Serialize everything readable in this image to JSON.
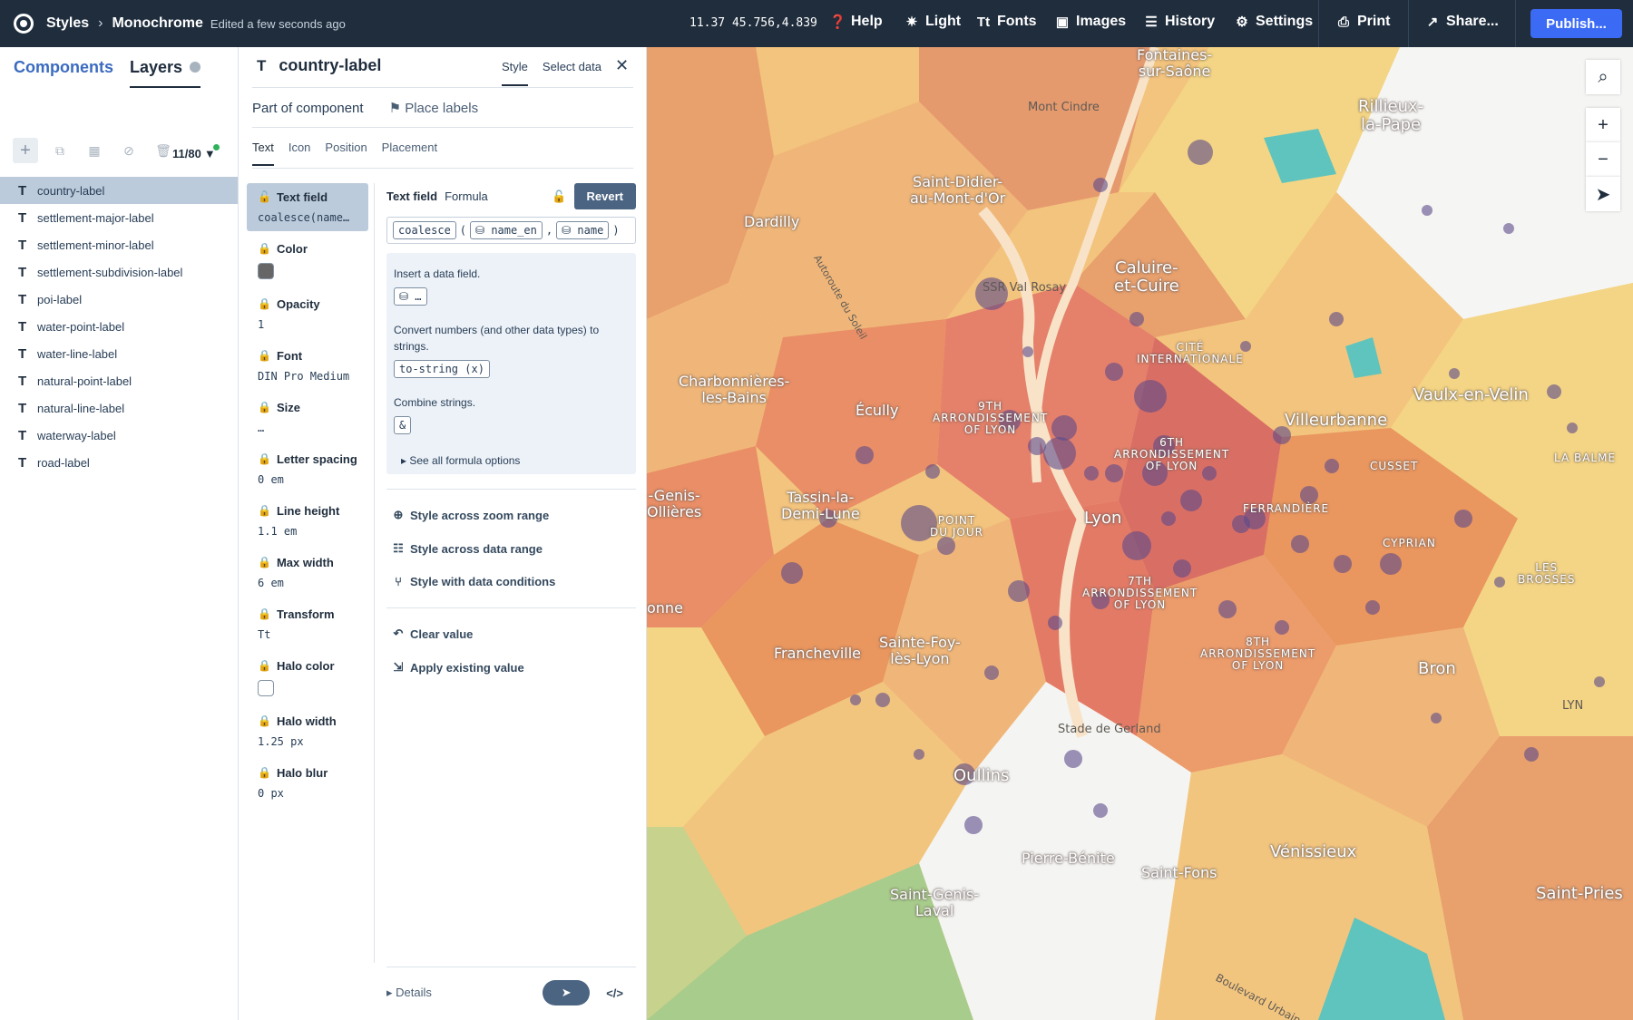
{
  "topbar": {
    "app": "Styles",
    "style_name": "Monochrome",
    "edited": "Edited a few seconds ago",
    "coords": "11.37 45.756,4.839",
    "menu": [
      {
        "label": "Help",
        "icon": "help-icon"
      },
      {
        "label": "Light",
        "icon": "light-icon"
      },
      {
        "label": "Fonts",
        "icon": "fonts-icon"
      },
      {
        "label": "Images",
        "icon": "images-icon"
      },
      {
        "label": "History",
        "icon": "history-icon"
      },
      {
        "label": "Settings",
        "icon": "settings-icon"
      },
      {
        "label": "Print",
        "icon": "print-icon"
      },
      {
        "label": "Share...",
        "icon": "share-icon"
      }
    ],
    "publish": "Publish..."
  },
  "left": {
    "tabs": [
      "Components",
      "Layers"
    ],
    "count": "11/80",
    "layers": [
      "country-label",
      "settlement-major-label",
      "settlement-minor-label",
      "settlement-subdivision-label",
      "poi-label",
      "water-point-label",
      "water-line-label",
      "natural-point-label",
      "natural-line-label",
      "waterway-label",
      "road-label"
    ],
    "selected_layer": "country-label"
  },
  "panel": {
    "title": "country-label",
    "tabs": [
      "Style",
      "Select data"
    ],
    "part_of": "Part of component",
    "component": "Place labels",
    "subtabs": [
      "Text",
      "Icon",
      "Position",
      "Placement"
    ],
    "props": [
      {
        "label": "Text field",
        "value": "coalesce(name…"
      },
      {
        "label": "Color",
        "value": ""
      },
      {
        "label": "Opacity",
        "value": "1"
      },
      {
        "label": "Font",
        "value": "DIN Pro Medium"
      },
      {
        "label": "Size",
        "value": "…"
      },
      {
        "label": "Letter spacing",
        "value": "0 em"
      },
      {
        "label": "Line height",
        "value": "1.1 em"
      },
      {
        "label": "Max width",
        "value": "6 em"
      },
      {
        "label": "Transform",
        "value": "Tt"
      },
      {
        "label": "Halo color",
        "value": ""
      },
      {
        "label": "Halo width",
        "value": "1.25 px"
      },
      {
        "label": "Halo blur",
        "value": "0 px"
      }
    ],
    "field_label": "Text field",
    "field_mode": "Formula",
    "revert": "Revert",
    "expr": {
      "fn": "coalesce",
      "a": "name_en",
      "b": "name"
    },
    "help": {
      "insert": "Insert a data field.",
      "insert_chip": "…",
      "convert": "Convert numbers (and other data types) to strings.",
      "convert_chip": "to-string (x)",
      "combine": "Combine strings.",
      "combine_chip": "&",
      "see_all": "See all formula options"
    },
    "actions": [
      "Style across zoom range",
      "Style across data range",
      "Style with data conditions"
    ],
    "actions2": [
      "Clear value",
      "Apply existing value"
    ],
    "details": "Details"
  },
  "map": {
    "labels": {
      "fontaines": "Fontaines-\nsur-Saône",
      "rillieux": "Rillieux-\nla-Pape",
      "montcindre": "Mont Cindre",
      "saintdidier": "Saint-Didier-\nau-Mont-d'Or",
      "dardilly": "Dardilly",
      "caluire": "Caluire-\net-Cuire",
      "ssrval": "SSR Val Rosay",
      "cite": "CITÉ\nINTERNATIONALE",
      "charbonnieres": "Charbonnières-\nles-Bains",
      "ecully": "Écully",
      "ninth": "9TH\nARRONDISSEMENT\nOF LYON",
      "sixth": "6TH\nARRONDISSEMENT\nOF LYON",
      "vaulx": "Vaulx-en-Velin",
      "villeurbanne": "Villeurbanne",
      "labalme": "LA BALME",
      "cusset": "CUSSET",
      "genis": "-Genis-\nOllières",
      "tassin": "Tassin-la-\nDemi-Lune",
      "pointdujour": "POINT\nDU JOUR",
      "lyon": "Lyon",
      "ferrandiere": "FERRANDIÈRE",
      "cyprian": "CYPRIAN",
      "lesbrosses": "LES\nBROSSES",
      "seventh": "7TH\nARRONDISSEMENT\nOF LYON",
      "onne": "onne",
      "saintefoy": "Sainte-Foy-\nlès-Lyon",
      "francheville": "Francheville",
      "eighth": "8TH\nARRONDISSEMENT\nOF LYON",
      "bron": "Bron",
      "lyn": "LYN",
      "stade": "Stade de Gerland",
      "oullins": "Oullins",
      "pierrebenite": "Pierre-Bénite",
      "saintfons": "Saint-Fons",
      "venissieux": "Vénissieux",
      "saintgenis": "Saint-Genis-\nLaval",
      "saintpries": "Saint-Pries",
      "boulevard": "Boulevard Urbain Sud",
      "autoroute": "Autoroute du Soleil"
    }
  }
}
